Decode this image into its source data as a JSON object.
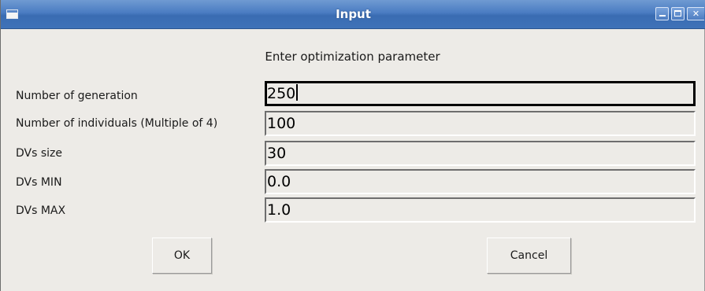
{
  "window": {
    "title": "Input"
  },
  "dialog": {
    "heading": "Enter optimization parameter",
    "fields": [
      {
        "label": "Number of generation",
        "value": "250",
        "focused": true
      },
      {
        "label": "Number of individuals (Multiple of 4)",
        "value": "100",
        "focused": false
      },
      {
        "label": "DVs size",
        "value": "30",
        "focused": false
      },
      {
        "label": "DVs MIN",
        "value": "0.0",
        "focused": false
      },
      {
        "label": "DVs MAX",
        "value": "1.0",
        "focused": false
      }
    ],
    "ok_label": "OK",
    "cancel_label": "Cancel"
  },
  "icons": {
    "window_menu": "window-menu-icon",
    "minimize": "minimize-icon",
    "maximize": "maximize-icon",
    "close": "close-icon"
  },
  "colors": {
    "titlebar": "#4a7cc2",
    "background": "#edebe7",
    "text": "#1a1a1a"
  }
}
